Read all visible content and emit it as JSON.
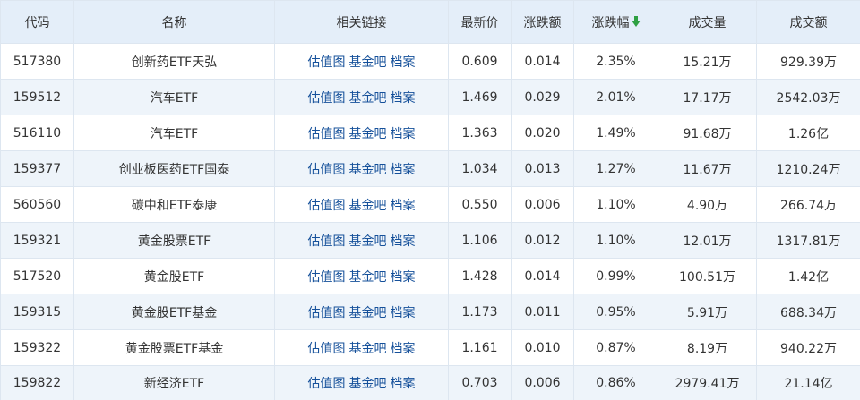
{
  "colors": {
    "header_bg": "#e4eef9",
    "link": "#15509a",
    "up": "#e81c1c",
    "sort_arrow": "#2ea043",
    "row_alt": "#eef4fa"
  },
  "headers": {
    "code": "代码",
    "name": "名称",
    "links": "相关链接",
    "price": "最新价",
    "change": "涨跌额",
    "pct": "涨跌幅",
    "volume": "成交量",
    "amount": "成交额"
  },
  "sort": {
    "column": "pct",
    "direction": "descending",
    "icon": "arrow-down-icon"
  },
  "links": {
    "valuation": "估值图",
    "forum": "基金吧",
    "archive": "档案"
  },
  "rows": [
    {
      "code": "517380",
      "name": "创新药ETF天弘",
      "price": "0.609",
      "change": "0.014",
      "pct": "2.35%",
      "volume": "15.21万",
      "amount": "929.39万"
    },
    {
      "code": "159512",
      "name": "汽车ETF",
      "price": "1.469",
      "change": "0.029",
      "pct": "2.01%",
      "volume": "17.17万",
      "amount": "2542.03万"
    },
    {
      "code": "516110",
      "name": "汽车ETF",
      "price": "1.363",
      "change": "0.020",
      "pct": "1.49%",
      "volume": "91.68万",
      "amount": "1.26亿"
    },
    {
      "code": "159377",
      "name": "创业板医药ETF国泰",
      "price": "1.034",
      "change": "0.013",
      "pct": "1.27%",
      "volume": "11.67万",
      "amount": "1210.24万"
    },
    {
      "code": "560560",
      "name": "碳中和ETF泰康",
      "price": "0.550",
      "change": "0.006",
      "pct": "1.10%",
      "volume": "4.90万",
      "amount": "266.74万"
    },
    {
      "code": "159321",
      "name": "黄金股票ETF",
      "price": "1.106",
      "change": "0.012",
      "pct": "1.10%",
      "volume": "12.01万",
      "amount": "1317.81万"
    },
    {
      "code": "517520",
      "name": "黄金股ETF",
      "price": "1.428",
      "change": "0.014",
      "pct": "0.99%",
      "volume": "100.51万",
      "amount": "1.42亿"
    },
    {
      "code": "159315",
      "name": "黄金股ETF基金",
      "price": "1.173",
      "change": "0.011",
      "pct": "0.95%",
      "volume": "5.91万",
      "amount": "688.34万"
    },
    {
      "code": "159322",
      "name": "黄金股票ETF基金",
      "price": "1.161",
      "change": "0.010",
      "pct": "0.87%",
      "volume": "8.19万",
      "amount": "940.22万"
    },
    {
      "code": "159822",
      "name": "新经济ETF",
      "price": "0.703",
      "change": "0.006",
      "pct": "0.86%",
      "volume": "2979.41万",
      "amount": "21.14亿"
    }
  ]
}
